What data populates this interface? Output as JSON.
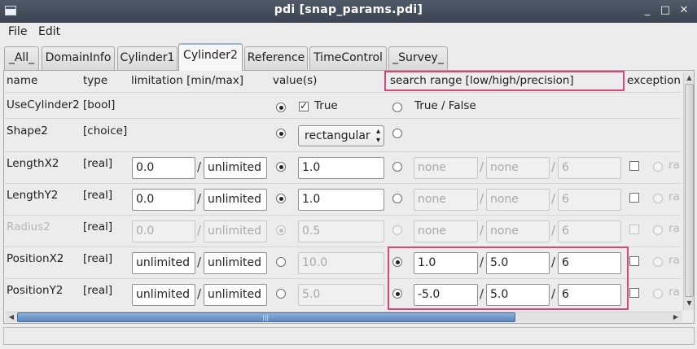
{
  "window": {
    "title": "pdi [snap_params.pdi]",
    "minimize": "_",
    "maximize": "□",
    "close": "✕"
  },
  "menu": [
    "File",
    "Edit"
  ],
  "tabs": [
    "_All_",
    "DomainInfo",
    "Cylinder1",
    "Cylinder2",
    "Reference",
    "TimeControl",
    "_Survey_"
  ],
  "active_tab": "Cylinder2",
  "headers": {
    "name": "name",
    "type": "type",
    "limitation": "limitation [min/max]",
    "values": "value(s)",
    "search": "search range [low/high/precision]",
    "exception": "exception"
  },
  "sep": "/",
  "rows": [
    {
      "name": "UseCylinder2",
      "type": "[bool]",
      "value_check": "True",
      "alt": "True / False"
    },
    {
      "name": "Shape2",
      "type": "[choice]",
      "value": "rectangular"
    },
    {
      "name": "LengthX2",
      "type": "[real]",
      "min": "0.0",
      "max": "unlimited",
      "value": "1.0",
      "low": "none",
      "high": "none",
      "prec": "6",
      "exc": "ra"
    },
    {
      "name": "LengthY2",
      "type": "[real]",
      "min": "0.0",
      "max": "unlimited",
      "value": "1.0",
      "low": "none",
      "high": "none",
      "prec": "6",
      "exc": "ra"
    },
    {
      "name": "Radius2",
      "type": "[real]",
      "min": "0.0",
      "max": "unlimited",
      "value": "0.5",
      "low": "none",
      "high": "none",
      "prec": "6",
      "exc": "ra"
    },
    {
      "name": "PositionX2",
      "type": "[real]",
      "min": "unlimited",
      "max": "unlimited",
      "value": "10.0",
      "low": "1.0",
      "high": "5.0",
      "prec": "6",
      "exc": "ra"
    },
    {
      "name": "PositionY2",
      "type": "[real]",
      "min": "unlimited",
      "max": "unlimited",
      "value": "5.0",
      "low": "-5.0",
      "high": "5.0",
      "prec": "6",
      "exc": "ra"
    }
  ],
  "colors": {
    "highlight": "#d8467b",
    "titlebar": "#3b4350",
    "scroll_thumb": "#5d86bd"
  }
}
